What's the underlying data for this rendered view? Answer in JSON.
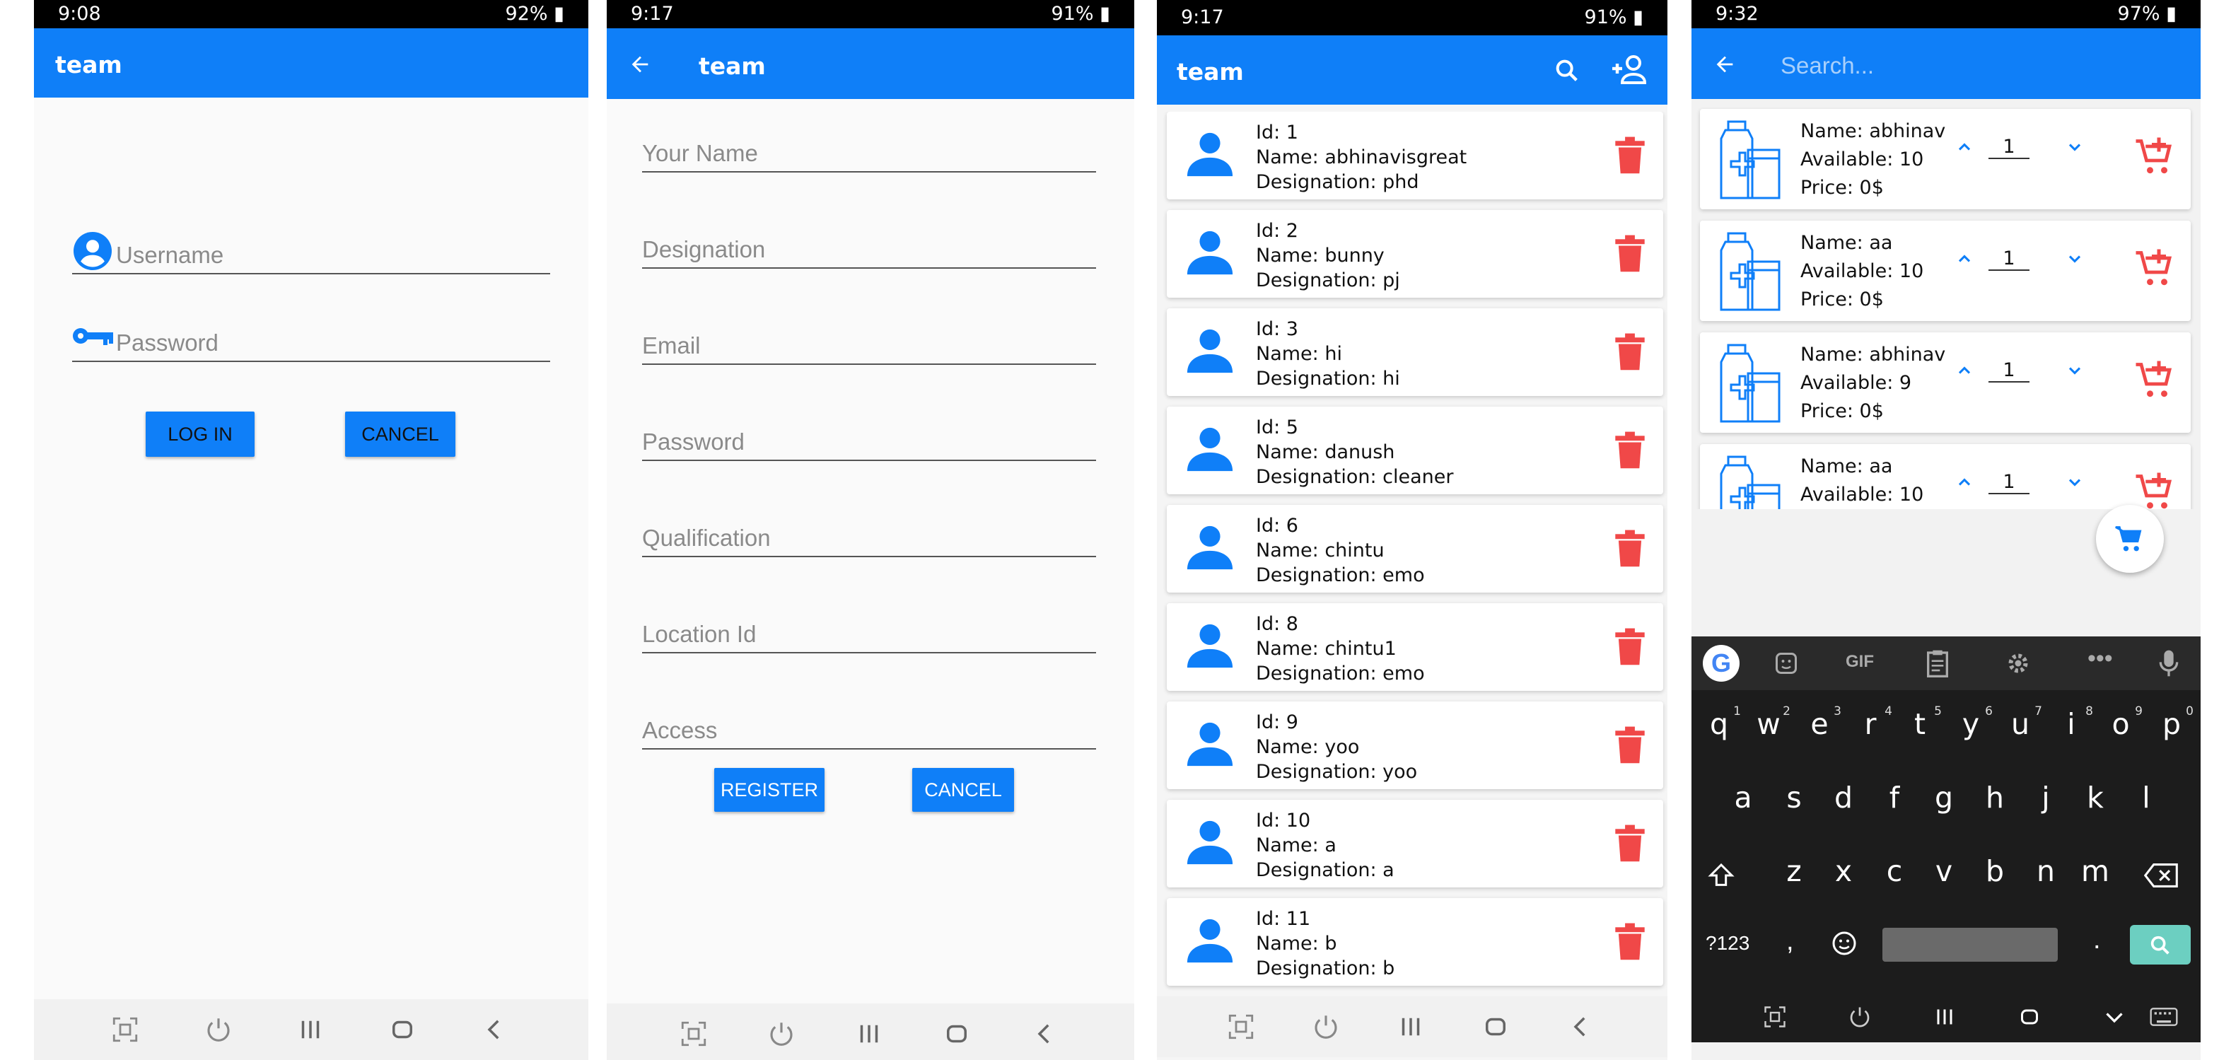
{
  "screens": {
    "login": {
      "status_time": "9:08",
      "status_battery": "92%",
      "title": "team",
      "username_placeholder": "Username",
      "password_placeholder": "Password",
      "login_label": "LOG IN",
      "cancel_label": "CANCEL"
    },
    "register": {
      "status_time": "9:17",
      "status_battery": "91%",
      "title": "team",
      "fields": [
        "Your Name",
        "Designation",
        "Email",
        "Password",
        "Qualification",
        "Location Id",
        "Access"
      ],
      "register_label": "REGISTER",
      "cancel_label": "CANCEL"
    },
    "team_list": {
      "status_time": "9:17",
      "status_battery": "91%",
      "title": "team",
      "members": [
        {
          "id": "Id: 1",
          "name": "Name: abhinavisgreat",
          "designation": "Designation: phd"
        },
        {
          "id": "Id: 2",
          "name": "Name: bunny",
          "designation": "Designation: pj"
        },
        {
          "id": "Id: 3",
          "name": "Name: hi",
          "designation": "Designation: hi"
        },
        {
          "id": "Id: 5",
          "name": "Name: danush",
          "designation": "Designation: cleaner"
        },
        {
          "id": "Id: 6",
          "name": "Name: chintu",
          "designation": "Designation: emo"
        },
        {
          "id": "Id: 8",
          "name": "Name: chintu1",
          "designation": "Designation: emo"
        },
        {
          "id": "Id: 9",
          "name": "Name: yoo",
          "designation": "Designation: yoo"
        },
        {
          "id": "Id: 10",
          "name": "Name: a",
          "designation": "Designation: a"
        },
        {
          "id": "Id: 11",
          "name": "Name: b",
          "designation": "Designation: b"
        }
      ]
    },
    "search": {
      "status_time": "9:32",
      "status_battery": "97%",
      "search_placeholder": "Search...",
      "products": [
        {
          "name": "Name: abhinav",
          "available": "Available: 10",
          "price": "Price: 0$",
          "qty": "1"
        },
        {
          "name": "Name: aa",
          "available": "Available: 10",
          "price": "Price: 0$",
          "qty": "1"
        },
        {
          "name": "Name: abhinav",
          "available": "Available: 9",
          "price": "Price: 0$",
          "qty": "1"
        },
        {
          "name": "Name: aa",
          "available": "Available: 10",
          "price": "",
          "qty": "1"
        }
      ],
      "keyboard": {
        "row1": [
          "q",
          "w",
          "e",
          "r",
          "t",
          "y",
          "u",
          "i",
          "o",
          "p"
        ],
        "row1_numbers": [
          "1",
          "2",
          "3",
          "4",
          "5",
          "6",
          "7",
          "8",
          "9",
          "0"
        ],
        "row2": [
          "a",
          "s",
          "d",
          "f",
          "g",
          "h",
          "j",
          "k",
          "l"
        ],
        "row3": [
          "z",
          "x",
          "c",
          "v",
          "b",
          "n",
          "m"
        ],
        "symbols_key": "?123",
        "comma_key": ",",
        "period_key": ".",
        "gif_label": "GIF"
      }
    }
  },
  "colors": {
    "primary": "#0f7ff8",
    "danger": "#f04848",
    "status_bar": "#000000"
  },
  "icons": [
    "user-circle-icon",
    "key-icon",
    "back-arrow-icon",
    "search-icon",
    "add-person-icon",
    "person-icon",
    "trash-icon",
    "medicine-bottle-icon",
    "chevron-up-icon",
    "chevron-down-icon",
    "add-cart-icon",
    "cart-icon",
    "google-icon",
    "mic-icon"
  ]
}
